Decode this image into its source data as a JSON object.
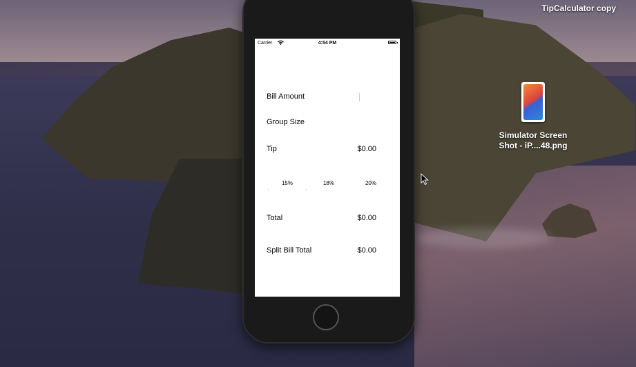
{
  "desktop": {
    "title": "TipCalculator copy",
    "file": {
      "icon": "screenshot-file-icon",
      "label_line1": "Simulator Screen",
      "label_line2": "Shot - iP....48.png"
    }
  },
  "status_bar": {
    "carrier": "Carrier",
    "time": "4:54 PM"
  },
  "form": {
    "bill_amount": {
      "label": "Bill Amount",
      "value": ""
    },
    "group_size": {
      "label": "Group Size",
      "value": ""
    },
    "tip": {
      "label": "Tip",
      "value": "$0.00"
    },
    "tip_options": [
      "15%",
      "18%",
      "20%"
    ],
    "total": {
      "label": "Total",
      "value": "$0.00"
    },
    "split": {
      "label": "Split Bill Total",
      "value": "$0.00"
    }
  }
}
